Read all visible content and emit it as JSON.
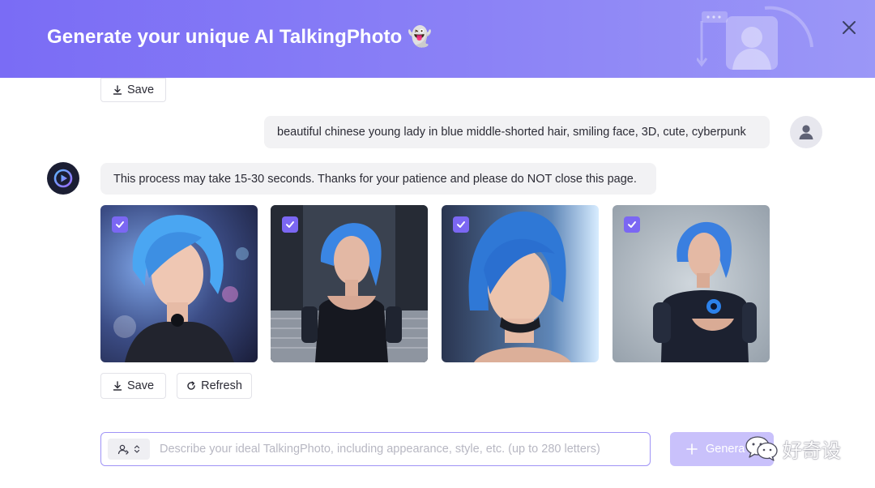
{
  "header": {
    "title": "Generate your unique AI TalkingPhoto 👻",
    "close_icon": "close-icon",
    "decoration_icon": "talking-photo-illustration"
  },
  "top_actions": {
    "save_label": "Save"
  },
  "conversation": {
    "user_prompt": "beautiful chinese young lady in blue middle-shorted hair, smiling face, 3D, cute, cyberpunk",
    "bot_message": "This process may take 15-30 seconds. Thanks for your patience and please do NOT close this page."
  },
  "results": {
    "images": [
      {
        "alt": "generated portrait 1",
        "selected": true
      },
      {
        "alt": "generated portrait 2",
        "selected": true
      },
      {
        "alt": "generated portrait 3",
        "selected": true
      },
      {
        "alt": "generated portrait 4",
        "selected": true
      }
    ],
    "save_label": "Save",
    "refresh_label": "Refresh"
  },
  "composer": {
    "placeholder": "Describe your ideal TalkingPhoto, including appearance, style, etc. (up to 280 letters)",
    "value": "",
    "generate_label": "Genera"
  },
  "watermark": {
    "text": "好奇设"
  },
  "colors": {
    "accent": "#7b67f3",
    "header_gradient_start": "#7a6cf5",
    "header_gradient_end": "#9b97f7",
    "bubble_bg": "#f2f2f4",
    "generate_disabled": "#c9c1fb"
  }
}
